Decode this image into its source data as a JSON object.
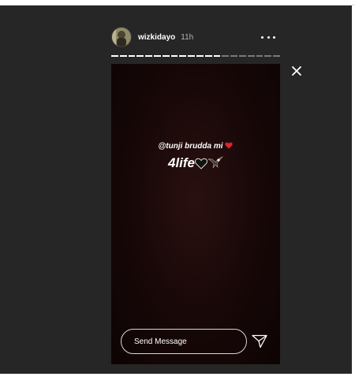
{
  "story": {
    "username": "wizkidayo",
    "time": "11h",
    "mention_text": "@tunji brudda mi",
    "main_text": "4life",
    "progress": {
      "segments_total": 20,
      "segments_filled": 13
    },
    "reply_placeholder": "Send Message"
  },
  "colors": {
    "page_background": "#262626",
    "story_background": "#1a0707",
    "heart_red": "#e0242f",
    "text": "#ffffff"
  },
  "icons": [
    "avatar",
    "more-options-icon",
    "close-icon",
    "red-heart-icon",
    "black-heart-icon",
    "eagle-icon",
    "send-icon"
  ]
}
